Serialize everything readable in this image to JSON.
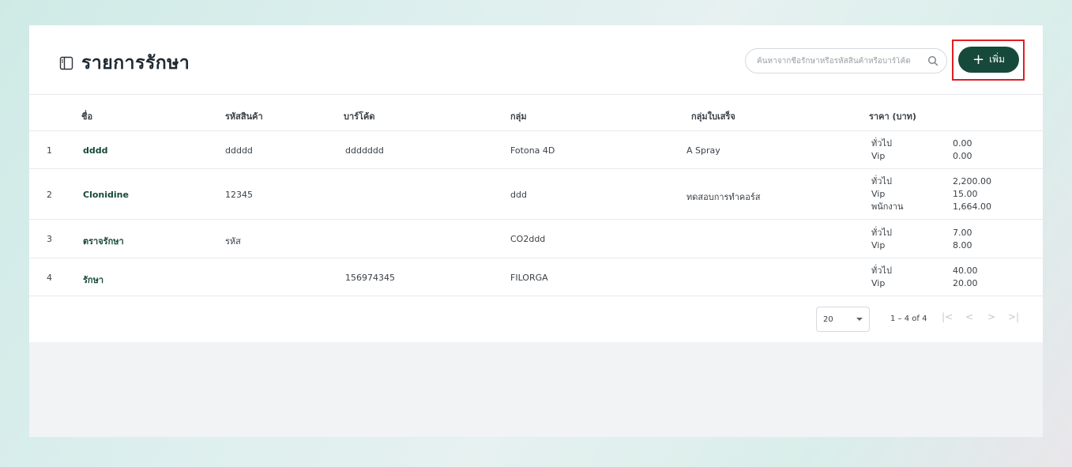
{
  "header": {
    "title": "รายการรักษา",
    "search_placeholder": "ค้นหาจากชื่อรักษาหรือรหัสสินค้าหรือบาร์โค้ด",
    "add_label": "เพิ่ม"
  },
  "table": {
    "columns": [
      "ชื่อ",
      "รหัสสินค้า",
      "บาร์โค้ด",
      "กลุ่ม",
      "กลุ่มใบเสร็จ",
      "ราคา (บาท)"
    ],
    "rows": [
      {
        "no": "1",
        "name": "dddd",
        "code": "ddddd",
        "barcode": "ddddddd",
        "group": "Fotona 4D",
        "receipt_group": "A Spray",
        "prices": [
          {
            "label": "ทั่วไป",
            "value": "0.00"
          },
          {
            "label": "Vip",
            "value": "0.00"
          }
        ]
      },
      {
        "no": "2",
        "name": "Clonidine",
        "code": "12345",
        "barcode": "",
        "group": "ddd",
        "receipt_group": "ทดสอบการทำคอร์ส",
        "prices": [
          {
            "label": "ทั่วไป",
            "value": "2,200.00"
          },
          {
            "label": "Vip",
            "value": "15.00"
          },
          {
            "label": "พนักงาน",
            "value": "1,664.00"
          }
        ]
      },
      {
        "no": "3",
        "name": "ตราจรักษา",
        "code": "รหัส",
        "barcode": "",
        "group": "CO2ddd",
        "receipt_group": "",
        "prices": [
          {
            "label": "ทั่วไป",
            "value": "7.00"
          },
          {
            "label": "Vip",
            "value": "8.00"
          }
        ]
      },
      {
        "no": "4",
        "name": "รักษา",
        "code": "",
        "barcode": "156974345",
        "group": "FILORGA",
        "receipt_group": "",
        "prices": [
          {
            "label": "ทั่วไป",
            "value": "40.00"
          },
          {
            "label": "Vip",
            "value": "20.00"
          }
        ]
      }
    ]
  },
  "pagination": {
    "page_size": "20",
    "range": "1 – 4 of 4",
    "first": "|<",
    "prev": "<",
    "next": ">",
    "last": ">|"
  },
  "colors": {
    "accent": "#17493b",
    "highlight": "#e01e24"
  }
}
